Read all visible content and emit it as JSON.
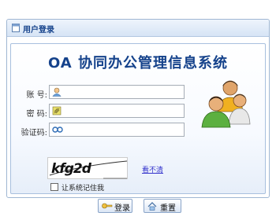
{
  "panel": {
    "title": "用户登录"
  },
  "login": {
    "system_title": "OA 协同办公管理信息系统",
    "username_label": "账 号:",
    "password_label": "密 码:",
    "captcha_label": "验证码:",
    "username_value": "",
    "password_value": "",
    "captcha_value": "",
    "captcha_image_text": "kfg2d",
    "refresh_link": "看不清",
    "remember_label": "让系统记住我",
    "remember_checked": false
  },
  "buttons": {
    "login": "登录",
    "reset": "重置"
  },
  "icons": {
    "header": "window-icon",
    "username": "user-icon",
    "password": "key-icon",
    "captcha": "link-icon",
    "users": "users-group-icon",
    "login_btn": "key-icon",
    "reset_btn": "home-icon"
  },
  "colors": {
    "title": "#15428b",
    "link": "#3333cc"
  }
}
